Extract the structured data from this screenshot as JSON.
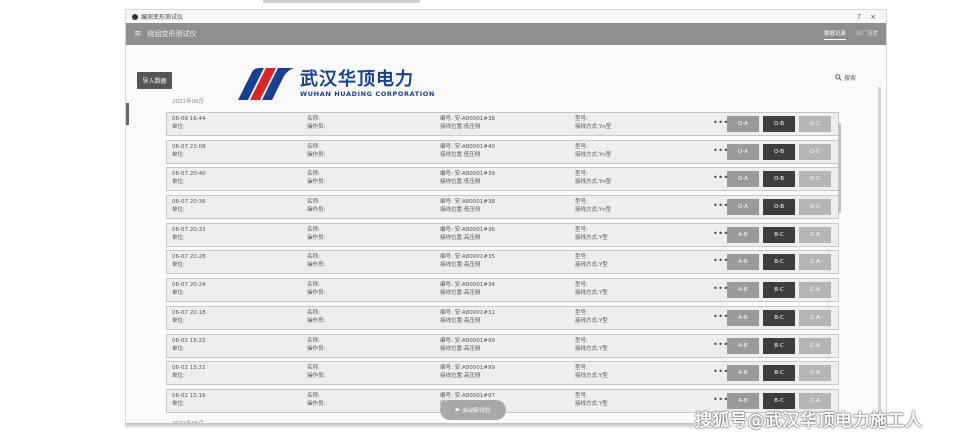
{
  "window": {
    "title": "编测变形测试仪",
    "minimize": "-",
    "maximize": "?",
    "close": "×"
  },
  "appbar": {
    "menu_icon": "menu-icon",
    "title": "绕组变形测试仪",
    "tabs": [
      {
        "label": "数据记录",
        "active": true
      },
      {
        "label": "出厂设置",
        "active": false
      }
    ]
  },
  "toolbar": {
    "import_label": "导入数据",
    "search_label": "搜索",
    "search_icon": "search-icon"
  },
  "logo": {
    "cn": "武汉华顶电力",
    "en": "WUHAN HUADING CORPORATION"
  },
  "months": {
    "first": "2021年06月",
    "second": "2021年05月"
  },
  "labels": {
    "name": "名称:",
    "operator": "操作员:",
    "unit": "单位:",
    "code": "编号:",
    "position": "接线位置:",
    "model": "型号:",
    "wiring": "接线方式:",
    "more": "•••"
  },
  "records": [
    {
      "time": "06-09 16:44",
      "code": "安:A80001#38",
      "position": "低压侧",
      "wiring": "Yn型",
      "phases": [
        "O-A",
        "O-B",
        "O-C"
      ]
    },
    {
      "time": "06-07 21:08",
      "code": "安:A80001#40",
      "position": "低压侧",
      "wiring": "Yn型",
      "phases": [
        "O-A",
        "O-B",
        "O-C"
      ]
    },
    {
      "time": "06-07 20:40",
      "code": "安:A80001#39",
      "position": "低压侧",
      "wiring": "Yn型",
      "phases": [
        "O-A",
        "O-B",
        "O-C"
      ]
    },
    {
      "time": "06-07 20:36",
      "code": "安:A80001#38",
      "position": "低压侧",
      "wiring": "Yn型",
      "phases": [
        "O-A",
        "O-B",
        "O-C"
      ]
    },
    {
      "time": "06-07 20:33",
      "code": "安:A80001#36",
      "position": "高压侧",
      "wiring": "Y型",
      "phases": [
        "A-B",
        "B-C",
        "C-A"
      ]
    },
    {
      "time": "06-07 20:28",
      "code": "安:A80001#35",
      "position": "高压侧",
      "wiring": "Y型",
      "phases": [
        "A-B",
        "B-C",
        "C-A"
      ]
    },
    {
      "time": "06-07 20:24",
      "code": "安:A80001#34",
      "position": "高压侧",
      "wiring": "Y型",
      "phases": [
        "A-B",
        "B-C",
        "C-A"
      ]
    },
    {
      "time": "06-07 20:18",
      "code": "安:A80001#31",
      "position": "高压侧",
      "wiring": "Y型",
      "phases": [
        "A-B",
        "B-C",
        "C-A"
      ]
    },
    {
      "time": "06-02 15:22",
      "code": "安:A80001#99",
      "position": "高压侧",
      "wiring": "Y型",
      "phases": [
        "A-B",
        "B-C",
        "C-A"
      ]
    },
    {
      "time": "06-02 15:22",
      "code": "安:A80001#99",
      "position": "高压侧",
      "wiring": "Y型",
      "phases": [
        "A-B",
        "B-C",
        "C-A"
      ]
    },
    {
      "time": "06-02 15:16",
      "code": "安:A80001#97",
      "position": "高压侧",
      "wiring": "Y型",
      "phases": [
        "A-B",
        "B-C",
        "C-A"
      ]
    }
  ],
  "fab": {
    "label": "启动新试验",
    "icon": "play-icon"
  },
  "watermark": "搜狐号@武汉华顶电力施工人",
  "colors": {
    "appbar": "#8e8e8e",
    "logo_blue": "#1a3f8f",
    "logo_red": "#d7262b",
    "phase_active": "#3d3d3d"
  }
}
